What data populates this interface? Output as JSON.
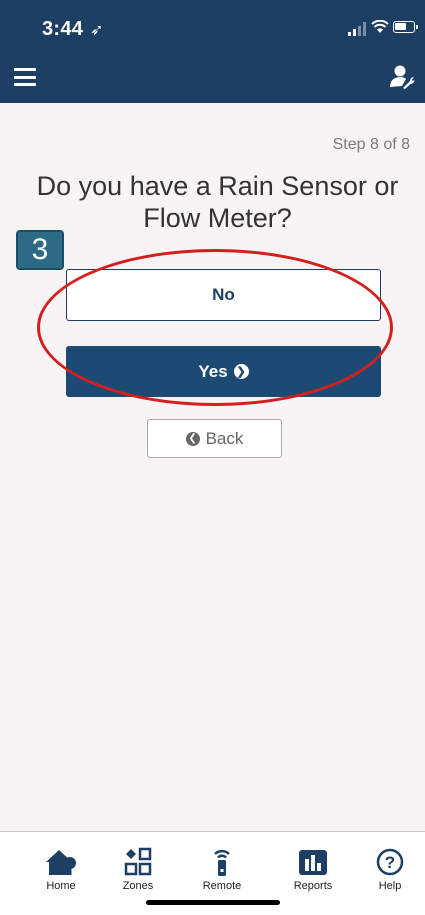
{
  "status_bar": {
    "time": "3:44",
    "location_arrow": "➶"
  },
  "header": {
    "menu_icon": "hamburger-menu-icon",
    "right_icon": "user-wrench-icon"
  },
  "wizard": {
    "step_text": "Step 8 of 8",
    "question": "Do you have a Rain Sensor or Flow Meter?",
    "badge": "3",
    "no_label": "No",
    "yes_label": "Yes",
    "back_label": "Back"
  },
  "tabs": [
    {
      "label": "Home",
      "icon": "home-icon"
    },
    {
      "label": "Zones",
      "icon": "zones-icon"
    },
    {
      "label": "Remote",
      "icon": "remote-icon"
    },
    {
      "label": "Reports",
      "icon": "reports-icon"
    },
    {
      "label": "Help",
      "icon": "help-icon"
    }
  ],
  "colors": {
    "brand": "#1d3f63",
    "accent_button": "#1d4a73",
    "annotation_red": "#d51f1f",
    "badge": "#2d6a86"
  }
}
